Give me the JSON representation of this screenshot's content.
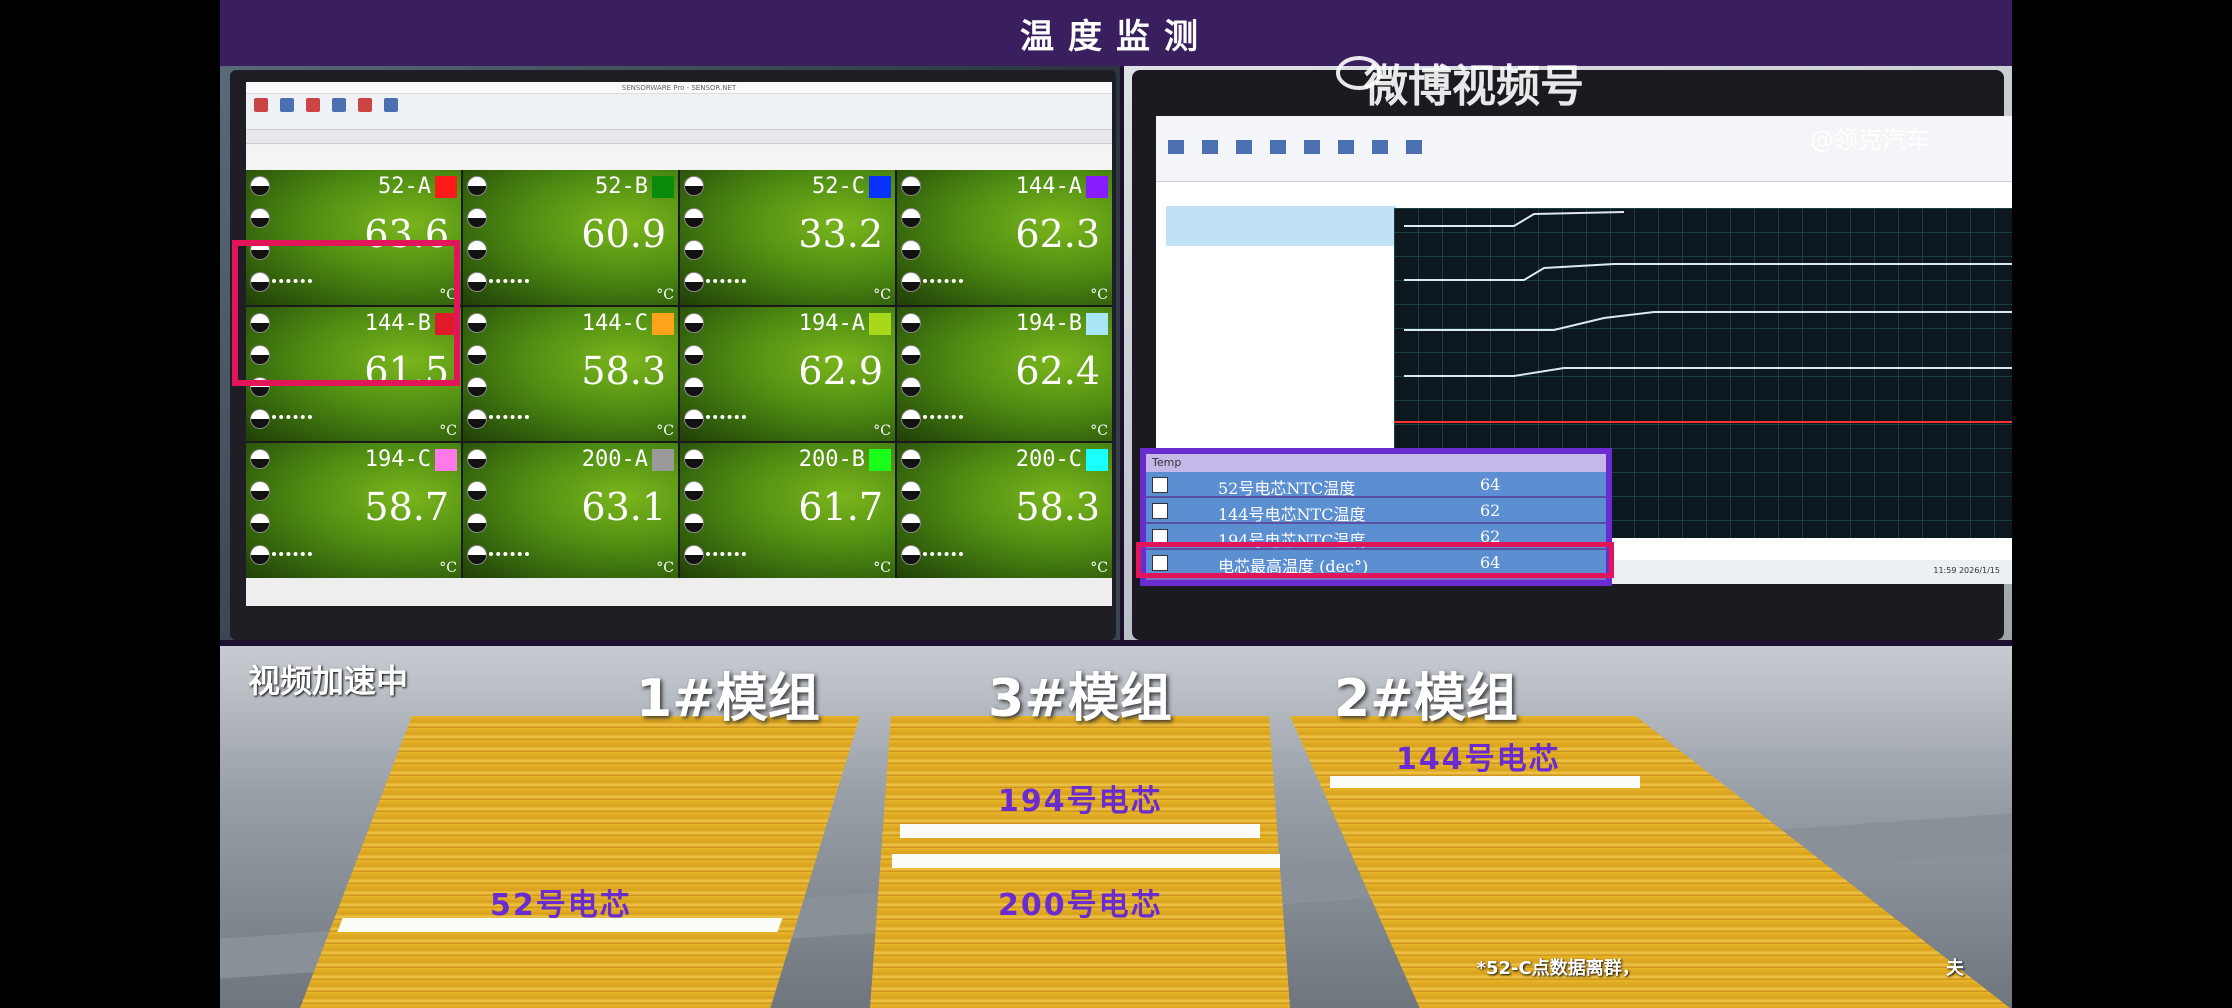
{
  "header": {
    "title": "温度监测"
  },
  "left_screen": {
    "window_title": "SENSORWARE Pro - SENSOR.NET",
    "highlighted_channel": "52-A",
    "channels": [
      {
        "name": "52-A",
        "value": "63.6",
        "unit": "°C",
        "color": "#ff1a1a"
      },
      {
        "name": "52-B",
        "value": "60.9",
        "unit": "°C",
        "color": "#0a8a0a"
      },
      {
        "name": "52-C",
        "value": "33.2",
        "unit": "°C",
        "color": "#0a32ff"
      },
      {
        "name": "144-A",
        "value": "62.3",
        "unit": "°C",
        "color": "#8a1aff"
      },
      {
        "name": "144-B",
        "value": "61.5",
        "unit": "°C",
        "color": "#e01a2a"
      },
      {
        "name": "144-C",
        "value": "58.3",
        "unit": "°C",
        "color": "#ffa31a"
      },
      {
        "name": "194-A",
        "value": "62.9",
        "unit": "°C",
        "color": "#a8d81a"
      },
      {
        "name": "194-B",
        "value": "62.4",
        "unit": "°C",
        "color": "#a8e6f7"
      },
      {
        "name": "194-C",
        "value": "58.7",
        "unit": "°C",
        "color": "#ff7ae8"
      },
      {
        "name": "200-A",
        "value": "63.1",
        "unit": "°C",
        "color": "#9a9a9a"
      },
      {
        "name": "200-B",
        "value": "61.7",
        "unit": "°C",
        "color": "#1aff1a"
      },
      {
        "name": "200-C",
        "value": "58.3",
        "unit": "°C",
        "color": "#1affff"
      }
    ]
  },
  "right_screen": {
    "temp_panel_title": "Temp",
    "rows": [
      {
        "label": "52号电芯NTC温度",
        "value": "64"
      },
      {
        "label": "144号电芯NTC温度",
        "value": "62"
      },
      {
        "label": "194号电芯NTC温度",
        "value": "62"
      },
      {
        "label": "电芯最高温度 (dec°)",
        "value": "64"
      }
    ],
    "taskbar_time": "11:59",
    "taskbar_date": "2026/1/15"
  },
  "watermark": {
    "brand": "微博视频号",
    "handle": "@领克汽车"
  },
  "photo": {
    "speed_label": "视频加速中",
    "modules": [
      "1#模组",
      "3#模组",
      "2#模组"
    ],
    "cell_labels": [
      "194号电芯",
      "144号电芯",
      "52号电芯",
      "200号电芯"
    ],
    "footnote": "*52-C点数据离群，",
    "footnote_tail": "夫"
  }
}
